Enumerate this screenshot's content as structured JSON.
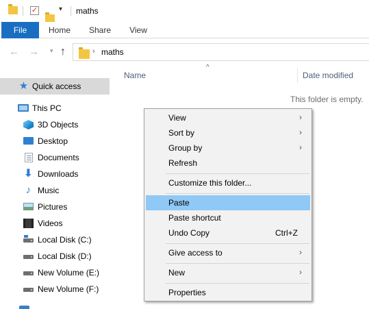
{
  "window": {
    "title": "maths"
  },
  "ribbon": {
    "tabs": [
      "File",
      "Home",
      "Share",
      "View"
    ]
  },
  "address": {
    "path": "maths"
  },
  "columns": {
    "name": "Name",
    "date_modified": "Date modified"
  },
  "content": {
    "empty_message": "This folder is empty."
  },
  "sidebar": {
    "items": [
      {
        "label": "Quick access",
        "icon": "star-icon"
      },
      {
        "label": "This PC",
        "icon": "computer-icon"
      },
      {
        "label": "3D Objects",
        "icon": "cube-icon"
      },
      {
        "label": "Desktop",
        "icon": "desktop-icon"
      },
      {
        "label": "Documents",
        "icon": "document-icon"
      },
      {
        "label": "Downloads",
        "icon": "download-arrow-icon"
      },
      {
        "label": "Music",
        "icon": "music-note-icon"
      },
      {
        "label": "Pictures",
        "icon": "picture-icon"
      },
      {
        "label": "Videos",
        "icon": "film-icon"
      },
      {
        "label": "Local Disk (C:)",
        "icon": "system-drive-icon"
      },
      {
        "label": "Local Disk (D:)",
        "icon": "drive-icon"
      },
      {
        "label": "New Volume (E:)",
        "icon": "drive-icon"
      },
      {
        "label": "New Volume (F:)",
        "icon": "drive-icon"
      }
    ]
  },
  "context_menu": {
    "view": "View",
    "sort_by": "Sort by",
    "group_by": "Group by",
    "refresh": "Refresh",
    "customize": "Customize this folder...",
    "paste": "Paste",
    "paste_shortcut": "Paste shortcut",
    "undo_copy": "Undo Copy",
    "undo_shortcut": "Ctrl+Z",
    "give_access": "Give access to",
    "new": "New",
    "properties": "Properties"
  },
  "colors": {
    "file_tab": "#1a6ec2",
    "menu_highlight": "#90c8f6",
    "header_text": "#4c607a"
  }
}
